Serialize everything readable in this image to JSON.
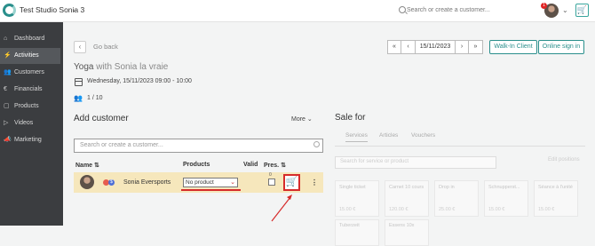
{
  "topbar": {
    "studio_name": "Test Studio Sonia 3",
    "search_placeholder": "Search or create a customer...",
    "notification_count": "1"
  },
  "sidebar": {
    "items": [
      {
        "label": "Dashboard",
        "icon": "home-icon"
      },
      {
        "label": "Activities",
        "icon": "activity-icon",
        "active": true
      },
      {
        "label": "Customers",
        "icon": "users-icon"
      },
      {
        "label": "Financials",
        "icon": "euro-icon"
      },
      {
        "label": "Products",
        "icon": "box-icon"
      },
      {
        "label": "Videos",
        "icon": "play-icon"
      },
      {
        "label": "Marketing",
        "icon": "megaphone-icon"
      }
    ]
  },
  "header": {
    "go_back": "Go back",
    "date": "15/11/2023",
    "walk_in_label": "Walk-In Client",
    "online_signin_label": "Online sign in",
    "first_icon": "«",
    "prev_icon": "‹",
    "next_icon": "›",
    "last_icon": "»"
  },
  "class_info": {
    "name": "Yoga",
    "teacher_with": "with Sonia la vraie",
    "datetime": "Wednesday, 15/11/2023 09:00 - 10:00",
    "attendance": "1 / 10"
  },
  "add_customer": {
    "heading": "Add customer",
    "more_label": "More",
    "search_placeholder": "Search or create a customer...",
    "columns": {
      "name": "Name",
      "products": "Products",
      "valid": "Valid",
      "pres": "Pres."
    },
    "rows": [
      {
        "name": "Sonia Eversports",
        "badge": "$",
        "product": "No product",
        "pres_count": "0"
      }
    ]
  },
  "sale": {
    "heading": "Sale for",
    "tabs": [
      "Services",
      "Articles",
      "Vouchers"
    ],
    "search_placeholder": "Search for service or product",
    "right_label": "Edit positions",
    "tiles": [
      {
        "name": "Single ticket",
        "price": "15.00 €"
      },
      {
        "name": "Carnet 10 cours",
        "price": "120.00 €"
      },
      {
        "name": "Drop in",
        "price": "25.00 €"
      },
      {
        "name": "Schnupperst...",
        "price": "15.00 €"
      },
      {
        "name": "Séance à l'unité",
        "price": "15.00 €"
      }
    ],
    "tiles_row2": [
      {
        "name": "Tuberzeit"
      },
      {
        "name": "Essens 10x"
      }
    ]
  },
  "colors": {
    "accent": "#2a8f8c",
    "sidebar": "#3b3d40",
    "highlight_row": "#f6e7bc",
    "annotation_red": "#d62b2b"
  }
}
